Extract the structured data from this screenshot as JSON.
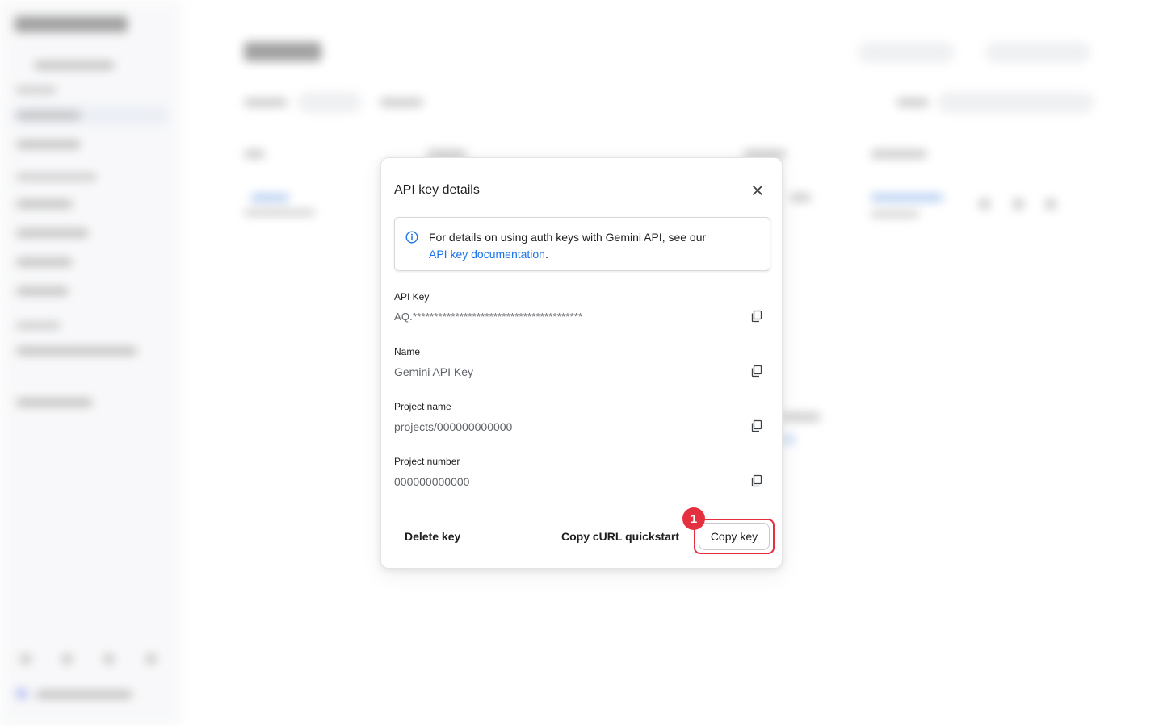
{
  "dialog": {
    "title": "API key details",
    "info": {
      "text": "For details on using auth keys with Gemini API, see our",
      "link_text": "API key documentation",
      "suffix": "."
    },
    "fields": [
      {
        "label": "API Key",
        "value": "AQ.****************************************"
      },
      {
        "label": "Name",
        "value": "Gemini API Key"
      },
      {
        "label": "Project name",
        "value": "projects/000000000000"
      },
      {
        "label": "Project number",
        "value": "000000000000"
      }
    ],
    "buttons": {
      "delete": "Delete key",
      "copy_curl": "Copy cURL quickstart",
      "copy_key": "Copy key"
    },
    "step_marker": "1"
  },
  "icons": {
    "close": "close-icon",
    "info": "info-icon",
    "copy": "copy-icon"
  },
  "colors": {
    "link": "#1a73e8",
    "highlight": "#e5313f"
  }
}
